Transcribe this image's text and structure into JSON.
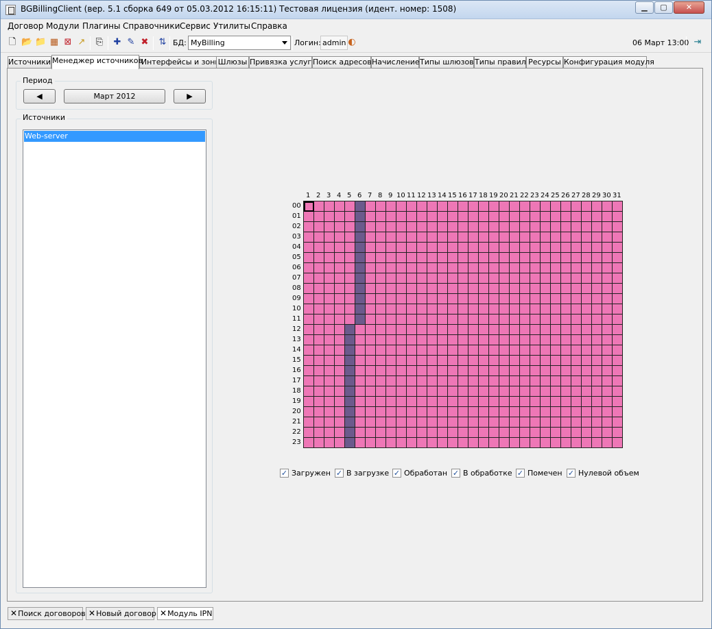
{
  "window": {
    "title": "BGBillingClient (вер. 5.1 сборка 649 от 05.03.2012 16:15:11) Тестовая лицензия (идент. номер: 1508)",
    "minimize": "▁",
    "maximize": "▢",
    "close": "✕"
  },
  "menu": [
    "Договор",
    "Модули",
    "Плагины",
    "Справочники",
    "Сервис",
    "Утилиты",
    "Справка"
  ],
  "toolbar": {
    "db_label": "БД:",
    "db_value": "MyBilling",
    "login_label": "Логин:",
    "login_value": "admin",
    "datetime": "06 Март 13:00"
  },
  "tabs": [
    "Источники",
    "Менеджер источников",
    "Интерфейсы и зоны",
    "Шлюзы",
    "Привязка услуг",
    "Поиск адресов",
    "Начисление",
    "Типы шлюзов",
    "Типы правил",
    "Ресурсы",
    "Конфигурация модуля"
  ],
  "active_tab": "Менеджер источников",
  "period": {
    "title": "Период",
    "prev": "◀",
    "value": "Март 2012",
    "next": "▶"
  },
  "sources": {
    "title": "Источники",
    "items": [
      "Web-server"
    ],
    "selected": "Web-server"
  },
  "calendar": {
    "days": [
      "1",
      "2",
      "3",
      "4",
      "5",
      "6",
      "7",
      "8",
      "9",
      "10",
      "11",
      "12",
      "13",
      "14",
      "15",
      "16",
      "17",
      "18",
      "19",
      "20",
      "21",
      "22",
      "23",
      "24",
      "25",
      "26",
      "27",
      "28",
      "29",
      "30",
      "31"
    ],
    "hours": [
      "00",
      "01",
      "02",
      "03",
      "04",
      "05",
      "06",
      "07",
      "08",
      "09",
      "10",
      "11",
      "12",
      "13",
      "14",
      "15",
      "16",
      "17",
      "18",
      "19",
      "20",
      "21",
      "22",
      "23"
    ],
    "status_color": "#ee77b6",
    "highlight_color": "#6c5a8c",
    "highlights": [
      {
        "day": 6,
        "hours": [
          0,
          1,
          2,
          3,
          4,
          5,
          6,
          7,
          8,
          9,
          10,
          11
        ]
      },
      {
        "day": 5,
        "hours": [
          12,
          13,
          14,
          15,
          16,
          17,
          18,
          19,
          20,
          21,
          22,
          23
        ]
      }
    ],
    "selected_cell": {
      "day": 1,
      "hour": 0
    }
  },
  "legend": [
    {
      "label": "Загружен",
      "checked": true
    },
    {
      "label": "В загрузке",
      "checked": true
    },
    {
      "label": "Обработан",
      "checked": true
    },
    {
      "label": "В обработке",
      "checked": true
    },
    {
      "label": "Помечен",
      "checked": true
    },
    {
      "label": "Нулевой объем",
      "checked": true
    }
  ],
  "checkmark": "✓",
  "bottom_tabs": [
    "Поиск договоров",
    "Новый договор",
    "Модуль IPN"
  ],
  "bottom_tab_close": "✕"
}
